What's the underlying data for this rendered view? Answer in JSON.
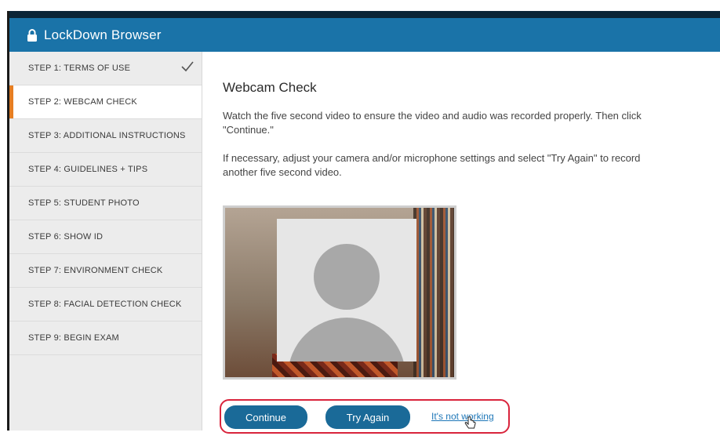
{
  "app": {
    "title": "LockDown Browser",
    "icon": "lock-icon"
  },
  "sidebar": {
    "steps": [
      {
        "label": "STEP 1: TERMS OF USE",
        "completed": true
      },
      {
        "label": "STEP 2: WEBCAM CHECK",
        "active": true
      },
      {
        "label": "STEP 3: ADDITIONAL INSTRUCTIONS"
      },
      {
        "label": "STEP 4: GUIDELINES + TIPS"
      },
      {
        "label": "STEP 5: STUDENT PHOTO"
      },
      {
        "label": "STEP 6: SHOW ID"
      },
      {
        "label": "STEP 7: ENVIRONMENT CHECK"
      },
      {
        "label": "STEP 8: FACIAL DETECTION CHECK"
      },
      {
        "label": "STEP 9: BEGIN EXAM"
      }
    ]
  },
  "main": {
    "heading": "Webcam Check",
    "instruction1": "Watch the five second video to ensure the video and audio was recorded properly. Then click \"Continue.\"",
    "instruction2": "If necessary, adjust your camera and/or microphone settings and select \"Try Again\" to record another five second video.",
    "video": {
      "placeholder_icon": "user-silhouette-icon"
    },
    "actions": {
      "continue_label": "Continue",
      "try_again_label": "Try Again",
      "not_working_label": "It's not working"
    }
  },
  "colors": {
    "titlebar": "#1a73a8",
    "active_indicator": "#e67e22",
    "button": "#1a6a98",
    "highlight_outline": "#d9243c",
    "link": "#1e77b8"
  }
}
